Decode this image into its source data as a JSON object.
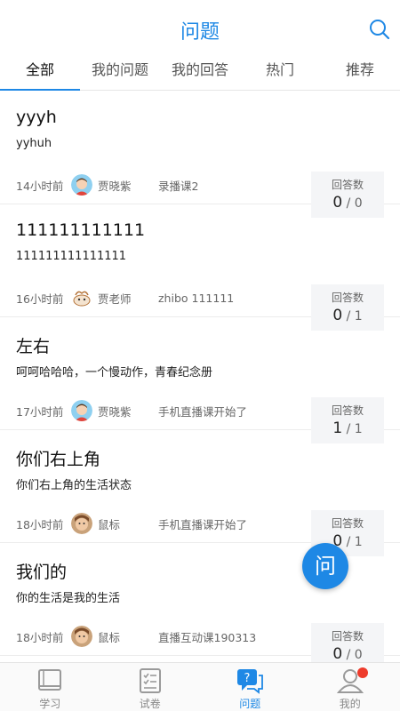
{
  "header": {
    "title": "问题"
  },
  "tabs": [
    {
      "label": "全部",
      "active": true
    },
    {
      "label": "我的问题",
      "active": false
    },
    {
      "label": "我的回答",
      "active": false
    },
    {
      "label": "热门",
      "active": false
    },
    {
      "label": "推荐",
      "active": false
    }
  ],
  "counts_label": "回答数",
  "items": [
    {
      "title": "yyyh",
      "desc": "yyhuh",
      "time": "14小时前",
      "author": "贾晓紫",
      "avatar": "boy-avatar",
      "course": "录播课2",
      "answers": "0",
      "total": "0"
    },
    {
      "title": "111111111111",
      "desc": "111111111111111",
      "time": "16小时前",
      "author": "贾老师",
      "avatar": "cartoon-avatar",
      "course": "zhibo 111111",
      "answers": "0",
      "total": "1"
    },
    {
      "title": "左右",
      "desc": "呵呵哈哈哈，一个慢动作，青春纪念册",
      "time": "17小时前",
      "author": "贾晓紫",
      "avatar": "boy-avatar",
      "course": "手机直播课开始了",
      "answers": "1",
      "total": "1"
    },
    {
      "title": "你们右上角",
      "desc": "你们右上角的生活状态",
      "time": "18小时前",
      "author": "鼠标",
      "avatar": "photo-avatar",
      "course": "手机直播课开始了",
      "answers": "0",
      "total": "1"
    },
    {
      "title": "我们的",
      "desc": "你的生活是我的生活",
      "time": "18小时前",
      "author": "鼠标",
      "avatar": "photo-avatar",
      "course": "直播互动课190313",
      "answers": "0",
      "total": "0"
    }
  ],
  "fab": {
    "label": "问"
  },
  "bottom_nav": [
    {
      "label": "学习",
      "icon": "book-icon",
      "active": false
    },
    {
      "label": "试卷",
      "icon": "paper-icon",
      "active": false
    },
    {
      "label": "问题",
      "icon": "question-chat-icon",
      "active": true
    },
    {
      "label": "我的",
      "icon": "user-icon",
      "active": false
    }
  ],
  "colors": {
    "accent": "#1e88e5",
    "badge": "#ee3b2b"
  }
}
